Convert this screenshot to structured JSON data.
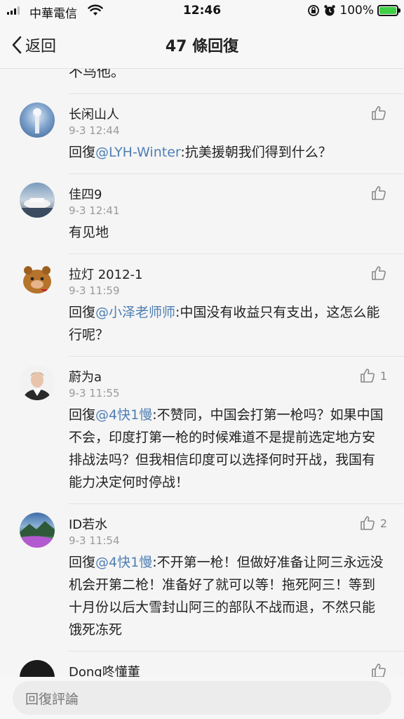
{
  "status_bar": {
    "carrier": "中華電信",
    "time": "12:46",
    "battery": "100%"
  },
  "nav": {
    "back_label": "返回",
    "title": "47 條回復"
  },
  "previous_comment_tail": "不鸟他。",
  "comments": [
    {
      "name": "长闲山人",
      "date": "9-3 12:44",
      "reply_prefix": "回復",
      "mention": "@LYH-Winter",
      "text": ":抗美援朝我们得到什么？",
      "likes": ""
    },
    {
      "name": "佳四9",
      "date": "9-3 12:41",
      "reply_prefix": "",
      "mention": "",
      "text": "有见地",
      "likes": ""
    },
    {
      "name": "拉灯 2012-1",
      "date": "9-3 11:59",
      "reply_prefix": "回復",
      "mention": "@小泽老师师",
      "text": ":中国没有收益只有支出，这怎么能行呢？",
      "likes": ""
    },
    {
      "name": "蔚为a",
      "date": "9-3 11:55",
      "reply_prefix": "回復",
      "mention": "@4快1慢",
      "text": ":不赞同，中国会打第一枪吗？如果中国不会，印度打第一枪的时候难道不是提前选定地方安排战法吗？但我相信印度可以选择何时开战，我国有能力决定何时停战！",
      "likes": "1"
    },
    {
      "name": "ID若水",
      "date": "9-3 11:54",
      "reply_prefix": "回復",
      "mention": "@4快1慢",
      "text": ":不开第一枪！但做好准备让阿三永远没机会开第二枪！准备好了就可以等！拖死阿三！等到十月份以后大雪封山阿三的部队不战而退，不然只能饿死冻死",
      "likes": "2"
    },
    {
      "name": "Dong咚懂董",
      "date": "",
      "reply_prefix": "",
      "mention": "",
      "text": "",
      "likes": ""
    }
  ],
  "reply_bar": {
    "placeholder": "回復評論"
  }
}
